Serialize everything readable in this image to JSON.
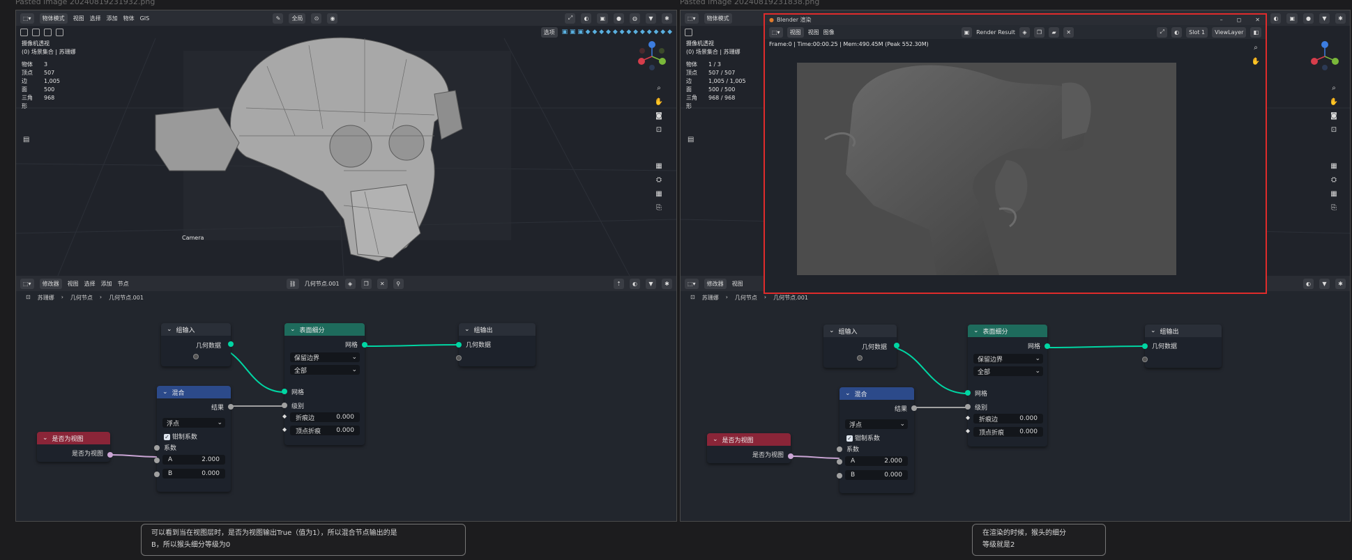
{
  "files": {
    "left": "Pasted image 20240819231932.png",
    "right": "Pasted image 20240819231838.png"
  },
  "left": {
    "viewport": {
      "mode": "物体模式",
      "menus": [
        "视图",
        "选择",
        "添加",
        "物体",
        "GIS"
      ],
      "orientation": "全局",
      "view_type": "选项",
      "camera_title": "摄像机透视",
      "collection": "(0) 场景集合 | 苏珊娜",
      "stats": [
        [
          "物体",
          "3"
        ],
        [
          "顶点",
          "507"
        ],
        [
          "边",
          "1,005"
        ],
        [
          "面",
          "500"
        ],
        [
          "三角形",
          "968"
        ]
      ],
      "camera_label": "Camera"
    },
    "node_editor": {
      "editor_type": "修改器",
      "menus": [
        "视图",
        "选择",
        "添加",
        "节点"
      ],
      "node_group": "几何节点.001",
      "breadcrumb": [
        "苏珊娜",
        "几何节点",
        "几何节点.001"
      ]
    }
  },
  "right": {
    "viewport": {
      "mode": "物体模式",
      "camera_title": "摄像机透视",
      "collection": "(0) 场景集合 | 苏珊娜",
      "stats": [
        [
          "物体",
          "1 / 3"
        ],
        [
          "顶点",
          "507 / 507"
        ],
        [
          "边",
          "1,005 / 1,005"
        ],
        [
          "面",
          "500 / 500"
        ],
        [
          "三角形",
          "968 / 968"
        ]
      ]
    },
    "node_editor": {
      "editor_type": "修改器",
      "menus": [
        "视图"
      ],
      "breadcrumb": [
        "苏珊娜",
        "几何节点",
        "几何节点.001"
      ]
    }
  },
  "nodes": {
    "group_input": {
      "title": "组输入",
      "out": "几何数据"
    },
    "group_output": {
      "title": "组输出",
      "in": "几何数据"
    },
    "subdiv": {
      "title": "表面细分",
      "out": "网格",
      "uv_smooth": "保留边界",
      "boundary": "全部",
      "in_mesh": "网格",
      "in_level": "级别",
      "crease_edge": "折痕边",
      "crease_edge_val": "0.000",
      "crease_vert": "顶点折痕",
      "crease_vert_val": "0.000"
    },
    "mix": {
      "title": "混合",
      "out": "结果",
      "type": "浮点",
      "clamp": "钳制系数",
      "factor": "系数",
      "a_label": "A",
      "a_val": "2.000",
      "b_label": "B",
      "b_val": "0.000"
    },
    "is_viewport": {
      "title": "是否为视图",
      "out": "是否为视图"
    }
  },
  "render_window": {
    "title": "Blender 渲染",
    "menus": [
      "视图",
      "视图",
      "图像"
    ],
    "image_name": "Render Result",
    "slot": "Slot 1",
    "view_layer": "ViewLayer",
    "info": "Frame:0 | Time:00:00.25 | Mem:490.45M (Peak 552.30M)"
  },
  "notes": {
    "left_line1": "可以看到当在视图层时，是否为视图输出True（值为1），所以混合节点输出的是",
    "left_line2": "B，所以猴头细分等级为0",
    "right_line1": "在渲染的时候，猴头的细分",
    "right_line2": "等级就是2"
  },
  "colors": {
    "subdiv_header": "#1e6b5c",
    "mix_header": "#2c4a8a",
    "bool_header": "#8a2538",
    "geometry_socket": "#00d6a3",
    "float_socket": "#a1a1a1",
    "bool_socket": "#cca6d6",
    "render_border": "#e02b2b"
  }
}
